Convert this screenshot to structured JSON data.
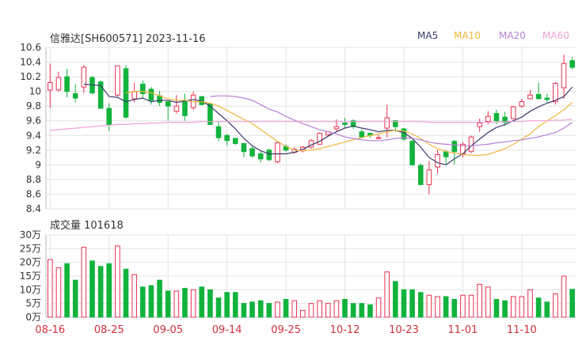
{
  "header": {
    "title": "信雅达[SH600571] 2023-11-16"
  },
  "legend": [
    {
      "label": "MA5",
      "color": "#3a3a6e"
    },
    {
      "label": "MA10",
      "color": "#f2b53d"
    },
    {
      "label": "MA20",
      "color": "#b77fd6"
    },
    {
      "label": "MA60",
      "color": "#f0a0d8"
    }
  ],
  "volume_panel": {
    "label": "成交量 101618"
  },
  "colors": {
    "up": "#e83050",
    "down": "#11b33c",
    "grid": "#e4e4e4",
    "axis_text": "#333333",
    "date_text": "#d1303e"
  },
  "chart_data": [
    {
      "type": "candlestick",
      "title": "信雅达[SH600571] 2023-11-16",
      "ylim": [
        8.4,
        10.6
      ],
      "yticks": [
        "10.6",
        "10.4",
        "10.2",
        "10",
        "9.8",
        "9.6",
        "9.4",
        "9.2",
        "9",
        "8.8",
        "8.6",
        "8.4"
      ],
      "x_tick_labels": [
        {
          "label": "08-16",
          "index": 0
        },
        {
          "label": "08-25",
          "index": 7
        },
        {
          "label": "09-05",
          "index": 14
        },
        {
          "label": "09-14",
          "index": 21
        },
        {
          "label": "09-25",
          "index": 28
        },
        {
          "label": "10-12",
          "index": 35
        },
        {
          "label": "10-23",
          "index": 42
        },
        {
          "label": "11-01",
          "index": 49
        },
        {
          "label": "11-10",
          "index": 56
        }
      ],
      "candles": [
        [
          10.02,
          10.12,
          9.77,
          10.38
        ],
        [
          10.02,
          10.19,
          10.0,
          10.27
        ],
        [
          10.2,
          10.0,
          9.92,
          10.31
        ],
        [
          9.97,
          9.91,
          9.85,
          10.1
        ],
        [
          10.06,
          10.33,
          9.98,
          10.36
        ],
        [
          10.19,
          9.98,
          9.96,
          10.21
        ],
        [
          10.13,
          9.77,
          9.77,
          10.15
        ],
        [
          9.77,
          9.55,
          9.46,
          9.84
        ],
        [
          9.95,
          10.35,
          9.93,
          10.35
        ],
        [
          10.31,
          9.65,
          9.63,
          10.36
        ],
        [
          9.9,
          10.0,
          9.85,
          10.12
        ],
        [
          10.1,
          9.97,
          9.9,
          10.15
        ],
        [
          10.03,
          9.88,
          9.82,
          10.06
        ],
        [
          9.94,
          9.85,
          9.8,
          10.01
        ],
        [
          9.86,
          9.8,
          9.6,
          9.86
        ],
        [
          9.73,
          9.8,
          9.7,
          9.95
        ],
        [
          9.87,
          9.67,
          9.6,
          9.97
        ],
        [
          9.78,
          9.95,
          9.75,
          10.0
        ],
        [
          9.93,
          9.82,
          9.82,
          9.92
        ],
        [
          9.83,
          9.55,
          9.55,
          9.83
        ],
        [
          9.52,
          9.37,
          9.32,
          9.6
        ],
        [
          9.4,
          9.33,
          9.26,
          9.42
        ],
        [
          9.36,
          9.29,
          9.27,
          9.36
        ],
        [
          9.29,
          9.18,
          9.1,
          9.3
        ],
        [
          9.22,
          9.12,
          9.1,
          9.26
        ],
        [
          9.15,
          9.08,
          9.03,
          9.18
        ],
        [
          9.2,
          9.07,
          9.05,
          9.22
        ],
        [
          9.04,
          9.3,
          9.02,
          9.31
        ],
        [
          9.25,
          9.2,
          9.18,
          9.28
        ],
        [
          9.17,
          9.21,
          9.15,
          9.24
        ],
        [
          9.19,
          9.24,
          9.17,
          9.26
        ],
        [
          9.24,
          9.33,
          9.22,
          9.35
        ],
        [
          9.28,
          9.43,
          9.28,
          9.44
        ],
        [
          9.41,
          9.45,
          9.39,
          9.46
        ],
        [
          9.49,
          9.52,
          9.45,
          9.62
        ],
        [
          9.57,
          9.55,
          9.5,
          9.64
        ],
        [
          9.6,
          9.52,
          9.49,
          9.62
        ],
        [
          9.45,
          9.38,
          9.37,
          9.48
        ],
        [
          9.43,
          9.4,
          9.37,
          9.42
        ],
        [
          9.37,
          9.37,
          9.36,
          9.41
        ],
        [
          9.5,
          9.64,
          9.37,
          9.82
        ],
        [
          9.6,
          9.52,
          9.45,
          9.61
        ],
        [
          9.49,
          9.35,
          9.33,
          9.5
        ],
        [
          9.32,
          9.0,
          8.98,
          9.34
        ],
        [
          8.99,
          8.73,
          8.72,
          9.02
        ],
        [
          8.73,
          8.93,
          8.6,
          9.05
        ],
        [
          8.97,
          9.14,
          8.88,
          9.2
        ],
        [
          9.18,
          9.11,
          9.0,
          9.2
        ],
        [
          9.32,
          9.18,
          9.0,
          9.34
        ],
        [
          9.15,
          9.28,
          9.1,
          9.31
        ],
        [
          9.18,
          9.38,
          9.16,
          9.4
        ],
        [
          9.52,
          9.57,
          9.45,
          9.63
        ],
        [
          9.59,
          9.66,
          9.55,
          9.73
        ],
        [
          9.7,
          9.6,
          9.55,
          9.75
        ],
        [
          9.65,
          9.58,
          9.53,
          9.72
        ],
        [
          9.63,
          9.79,
          9.62,
          9.8
        ],
        [
          9.8,
          9.86,
          9.78,
          9.9
        ],
        [
          9.9,
          9.95,
          9.9,
          10.02
        ],
        [
          9.96,
          9.9,
          9.9,
          10.12
        ],
        [
          9.91,
          9.89,
          9.85,
          9.97
        ],
        [
          9.86,
          10.11,
          9.82,
          10.13
        ],
        [
          10.05,
          10.38,
          9.9,
          10.5
        ],
        [
          10.42,
          10.33,
          10.3,
          10.47
        ]
      ],
      "series": [
        {
          "name": "MA5",
          "values": [
            null,
            null,
            null,
            null,
            10.1,
            10.09,
            10.08,
            9.93,
            9.92,
            9.86,
            9.89,
            9.91,
            9.86,
            9.88,
            9.88,
            9.85,
            9.87,
            9.89,
            9.87,
            9.8,
            9.7,
            9.6,
            9.49,
            9.36,
            9.26,
            9.19,
            9.15,
            9.15,
            9.15,
            9.17,
            9.21,
            9.27,
            9.32,
            9.39,
            9.45,
            9.5,
            9.53,
            9.5,
            9.48,
            9.45,
            9.47,
            9.47,
            9.44,
            9.36,
            9.24,
            9.1,
            9.03,
            9.0,
            9.08,
            9.15,
            9.26,
            9.35,
            9.44,
            9.51,
            9.55,
            9.6,
            9.65,
            9.73,
            9.79,
            9.84,
            9.88,
            9.93,
            10.06
          ]
        },
        {
          "name": "MA10",
          "values": [
            null,
            null,
            null,
            null,
            null,
            null,
            null,
            null,
            null,
            9.98,
            10.0,
            10.0,
            9.98,
            9.94,
            9.9,
            9.88,
            9.88,
            9.86,
            9.86,
            9.84,
            9.8,
            9.74,
            9.68,
            9.62,
            9.56,
            9.48,
            9.4,
            9.32,
            9.25,
            9.2,
            9.19,
            9.2,
            9.22,
            9.25,
            9.28,
            9.31,
            9.34,
            9.37,
            9.4,
            9.42,
            9.45,
            9.47,
            9.46,
            9.42,
            9.36,
            9.28,
            9.22,
            9.18,
            9.16,
            9.14,
            9.13,
            9.13,
            9.14,
            9.18,
            9.22,
            9.28,
            9.35,
            9.42,
            9.52,
            9.6,
            9.67,
            9.75,
            9.85
          ]
        },
        {
          "name": "MA20",
          "values": [
            null,
            null,
            null,
            null,
            null,
            null,
            null,
            null,
            null,
            null,
            null,
            null,
            null,
            null,
            null,
            null,
            null,
            null,
            null,
            9.93,
            9.94,
            9.94,
            9.93,
            9.91,
            9.88,
            9.82,
            9.76,
            9.72,
            9.66,
            9.61,
            9.56,
            9.52,
            9.48,
            9.45,
            9.42,
            9.38,
            9.36,
            9.34,
            9.33,
            9.33,
            9.34,
            9.36,
            9.37,
            9.36,
            9.34,
            9.31,
            9.29,
            9.28,
            9.27,
            9.26,
            9.26,
            9.27,
            9.28,
            9.3,
            9.31,
            9.33,
            9.34,
            9.36,
            9.38,
            9.41,
            9.44,
            9.5,
            9.58
          ]
        },
        {
          "name": "MA60",
          "values": [
            9.47,
            9.48,
            9.49,
            9.5,
            9.51,
            9.52,
            9.53,
            9.54,
            9.55,
            9.55,
            9.56,
            9.56,
            9.57,
            9.57,
            9.58,
            9.58,
            9.58,
            9.58,
            9.59,
            9.59,
            9.59,
            9.59,
            9.59,
            9.59,
            9.59,
            9.59,
            9.59,
            9.59,
            9.59,
            9.59,
            9.59,
            9.59,
            9.59,
            9.59,
            9.59,
            9.59,
            9.59,
            9.59,
            9.59,
            9.59,
            9.59,
            9.59,
            9.59,
            9.59,
            9.59,
            9.58,
            9.58,
            9.58,
            9.58,
            9.58,
            9.58,
            9.58,
            9.58,
            9.58,
            9.59,
            9.59,
            9.59,
            9.6,
            9.6,
            9.6,
            9.61,
            9.61,
            9.62
          ]
        }
      ]
    },
    {
      "type": "bar",
      "title": "成交量 101618",
      "ylim": [
        0,
        30
      ],
      "yticks": [
        "30万",
        "25万",
        "20万",
        "15万",
        "10万",
        "5万",
        "0万"
      ],
      "values": [
        21,
        18,
        19.5,
        13.5,
        25.5,
        20.5,
        18.5,
        19.5,
        26,
        17.5,
        15.5,
        11,
        11.5,
        13.5,
        9.5,
        9.5,
        10.5,
        10,
        11,
        10,
        7,
        9,
        9,
        5,
        5.5,
        6,
        5,
        5.5,
        6.5,
        6,
        2.5,
        5,
        6,
        5,
        6,
        6.5,
        5,
        5,
        4.5,
        7,
        16.5,
        13,
        10,
        10,
        9,
        8,
        7.5,
        7.5,
        6.5,
        8,
        8,
        12,
        11,
        6.5,
        6,
        7.5,
        7.5,
        10,
        7,
        5.5,
        8.5,
        15,
        10.16
      ]
    }
  ]
}
